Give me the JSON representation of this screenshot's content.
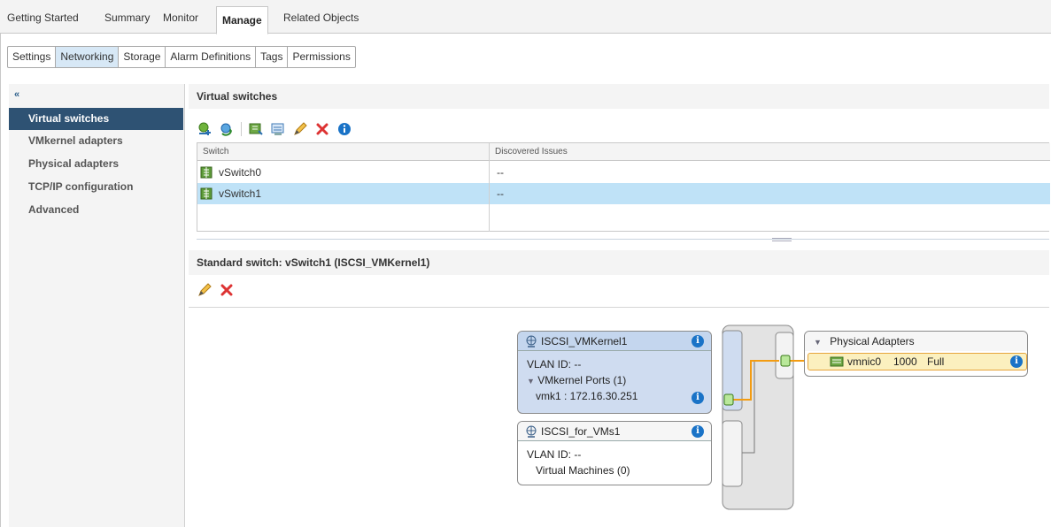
{
  "top_tabs": [
    "Getting Started",
    "Summary",
    "Monitor",
    "Manage",
    "Related Objects"
  ],
  "active_top_tab": "Manage",
  "sub_tabs": [
    "Settings",
    "Networking",
    "Storage",
    "Alarm Definitions",
    "Tags",
    "Permissions"
  ],
  "active_sub_tab": "Networking",
  "nav": {
    "collapse_glyph": "«",
    "items": [
      "Virtual switches",
      "VMkernel adapters",
      "Physical adapters",
      "TCP/IP configuration",
      "Advanced"
    ],
    "active": "Virtual switches"
  },
  "virtual_switches": {
    "title": "Virtual switches",
    "toolbar_icons": [
      "add-host-networking-icon",
      "refresh-icon",
      "add-physical-adapter-icon",
      "migrate-icon",
      "edit-pencil-icon",
      "delete-x-icon",
      "info-icon"
    ],
    "columns": [
      "Switch",
      "Discovered Issues"
    ],
    "rows": [
      {
        "switch": "vSwitch0",
        "issues": "--",
        "selected": false
      },
      {
        "switch": "vSwitch1",
        "issues": "--",
        "selected": true
      }
    ]
  },
  "standard_switch": {
    "title": "Standard switch: vSwitch1 (ISCSI_VMKernel1)",
    "toolbar_icons": [
      "edit-pencil-icon",
      "delete-x-icon"
    ]
  },
  "diagram": {
    "port_groups": [
      {
        "name": "ISCSI_VMKernel1",
        "vlan": "VLAN ID: --",
        "ports_label": "VMkernel Ports (1)",
        "port": "vmk1 : 172.16.30.251",
        "selected": true
      },
      {
        "name": "ISCSI_for_VMs1",
        "vlan": "VLAN ID: --",
        "ports_label": "Virtual Machines (0)",
        "selected": false
      }
    ],
    "physical_adapters": {
      "title": "Physical Adapters",
      "adapters": [
        {
          "name": "vmnic0",
          "speed": "1000",
          "duplex": "Full"
        }
      ]
    },
    "colors": {
      "link": "#f39c12",
      "selected_group": "#cfdcf0",
      "adapter_bg": "#fbf0bf",
      "adapter_border": "#e6a43a"
    }
  }
}
